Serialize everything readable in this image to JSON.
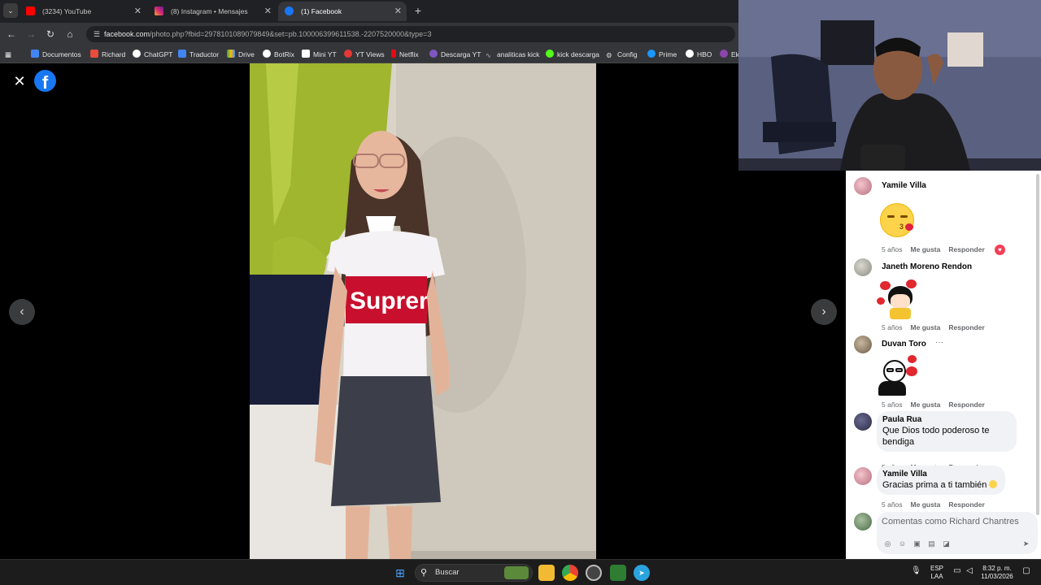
{
  "browser": {
    "tabs": [
      {
        "title": "(3234) YouTube",
        "color": "#ff0000"
      },
      {
        "title": "(8) Instagram • Mensajes",
        "color": "#d62976"
      },
      {
        "title": "(1) Facebook",
        "color": "#1877f2"
      }
    ],
    "new_tab": "+",
    "url_host": "facebook.com",
    "url_rest": "/photo.php?fbid=2978101089079849&set=pb.100006399611538.-2207520000&type=3",
    "bookmarks": [
      "Documentos",
      "Richard",
      "ChatGPT",
      "Traductor",
      "Drive",
      "BotRix",
      "Mini YT",
      "YT Views",
      "Netflix",
      "Descarga YT",
      "analiticas kick",
      "kick descarga",
      "Config",
      "Prime",
      "HBO",
      "Ek"
    ]
  },
  "viewer": {
    "close": "✕",
    "logo": "f",
    "prev": "‹",
    "next": "›",
    "shirt_text": "Suprer"
  },
  "comments": [
    {
      "name": "Yamile Villa",
      "time": "5 años",
      "like": "Me gusta",
      "reply": "Responder",
      "sticker": "kiss-emoji"
    },
    {
      "name": "Janeth Moreno Rendon",
      "time": "5 años",
      "like": "Me gusta",
      "reply": "Responder",
      "sticker": "girl-hearts-sticker"
    },
    {
      "name": "Duvan Toro",
      "time": "5 años",
      "like": "Me gusta",
      "reply": "Responder",
      "more": "···",
      "sticker": "boy-hearts-sticker"
    },
    {
      "name": "Paula Rua",
      "text_line1": "Que Dios todo poderoso te",
      "text_line2": "bendiga",
      "time": "5 años",
      "like": "Me gusta",
      "reply": "Responder"
    },
    {
      "name": "Yamile Villa",
      "text_line1": "Gracias prima a ti también",
      "time": "5 años",
      "like": "Me gusta",
      "reply": "Responder"
    }
  ],
  "compose": {
    "placeholder": "Comentas como Richard Chantres"
  },
  "taskbar": {
    "search_placeholder": "Buscar",
    "lang1": "ESP",
    "lang2": "LAA",
    "time": "8:32 p. m.",
    "date": "11/03/2026"
  },
  "colors": {
    "facebook_blue": "#1877f2",
    "supreme_red": "#c8102e",
    "reaction_love": "#f33e58"
  }
}
